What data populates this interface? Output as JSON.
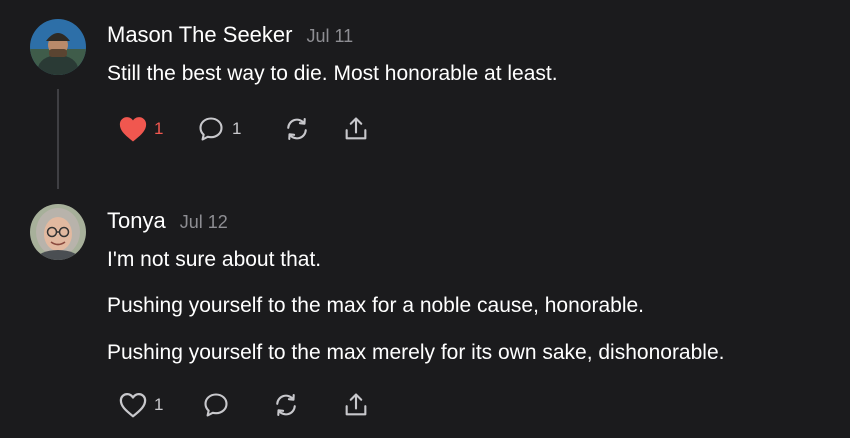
{
  "colors": {
    "background": "#1b1b1d",
    "text": "#ffffff",
    "muted": "#8e8e93",
    "like_active": "#f0574f",
    "thread_line": "#3f3f43"
  },
  "comments": [
    {
      "author": "Mason The Seeker",
      "date": "Jul 11",
      "avatar": "avatar-man-hat-icon",
      "body": [
        "Still the best way to die. Most honorable at least."
      ],
      "actions": {
        "liked": true,
        "like_count": "1",
        "reply_count": "1"
      }
    },
    {
      "author": "Tonya",
      "date": "Jul 12",
      "avatar": "avatar-woman-glasses-icon",
      "body": [
        "I'm not sure about that.",
        "Pushing yourself to the max for a noble cause, honorable.",
        "Pushing yourself to the max merely for its own sake, dishonorable."
      ],
      "actions": {
        "liked": false,
        "like_count": "1",
        "reply_count": ""
      }
    }
  ],
  "icons": {
    "like": "heart-icon",
    "reply": "speech-bubble-icon",
    "restack": "restack-icon",
    "share": "share-icon"
  }
}
